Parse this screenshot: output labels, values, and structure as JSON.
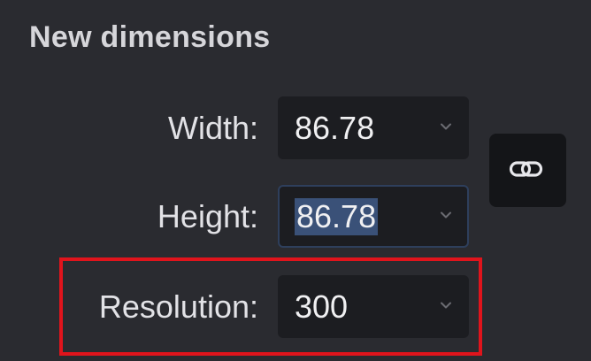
{
  "section": {
    "title": "New dimensions"
  },
  "fields": {
    "width": {
      "label": "Width:",
      "value": "86.78"
    },
    "height": {
      "label": "Height:",
      "value": "86.78",
      "selected": true
    },
    "resolution": {
      "label": "Resolution:",
      "value": "300"
    }
  },
  "link_button": {
    "icon": "link-icon"
  },
  "annotation": {
    "color": "#e0141c",
    "target": "resolution"
  },
  "colors": {
    "background": "#2a2b30",
    "field_background": "#1c1d21",
    "selection": "#3a5178"
  }
}
